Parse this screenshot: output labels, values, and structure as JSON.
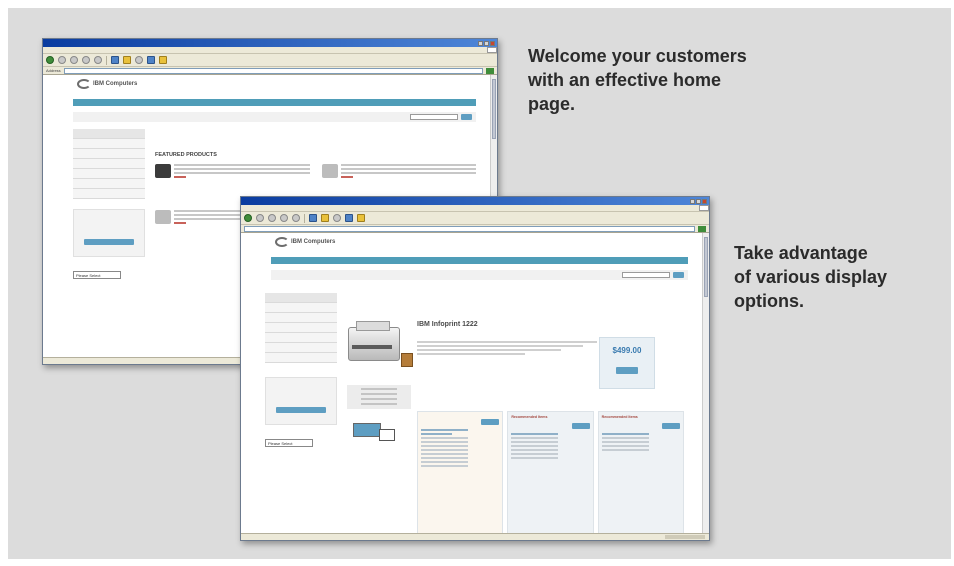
{
  "captions": {
    "home": [
      "Welcome your customers",
      "with an effective home",
      "page."
    ],
    "display": [
      "Take advantage",
      "of various display",
      "options."
    ]
  },
  "window1": {
    "brand": "IBM Computers",
    "section_heading": "FEATURED PRODUCTS",
    "address_label": "Address",
    "select_value": "Please Select"
  },
  "window2": {
    "brand": "IBM Computers",
    "product_title": "IBM Infoprint 1222",
    "price": "$499.00",
    "select_value": "Please Select",
    "recommendation_headings": [
      "Recommended Items",
      "Recommended Items"
    ]
  },
  "colors": {
    "panel": "#dcdcdc",
    "nav": "#4f9db8",
    "titlebar": "#0a3ca0",
    "accent": "#b0453b",
    "price": "#3a7bb0"
  }
}
